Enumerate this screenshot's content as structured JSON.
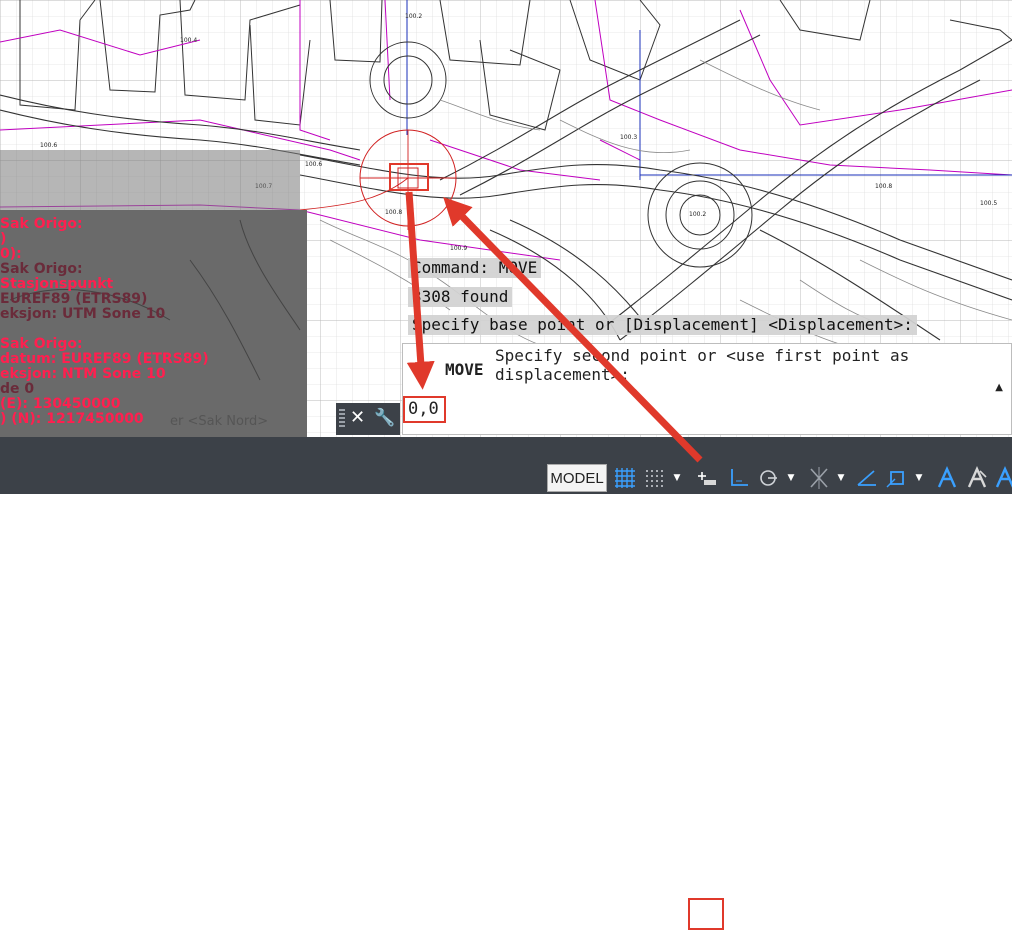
{
  "drawing": {
    "sidebar_lines": [
      {
        "text": "Sak Origo:",
        "tone": "red"
      },
      {
        "text": ")",
        "tone": "red"
      },
      {
        "text": "0):",
        "tone": "red"
      },
      {
        "text": "Sak Origo:",
        "tone": "dim"
      },
      {
        "text": "Stasjonspunkt",
        "tone": "red"
      },
      {
        "text": "EUREF89 (ETRS89)",
        "tone": "dim"
      },
      {
        "text": "eksjon: UTM Sone 10",
        "tone": "dim"
      },
      {
        "text": "",
        "tone": "dim"
      },
      {
        "text": "Sak Origo:",
        "tone": "red"
      },
      {
        "text": "datum: EUREF89 (ETRS89)",
        "tone": "red"
      },
      {
        "text": "eksjon: NTM Sone 10",
        "tone": "red"
      },
      {
        "text": "de 0",
        "tone": "dim"
      },
      {
        "text": "(E): 130450000",
        "tone": "red"
      },
      {
        "text": ") (N): 1217450000",
        "tone": "red"
      }
    ],
    "sidebar_note": "er <Sak Nord>"
  },
  "command_history": [
    "Command: MOVE",
    "3308 found",
    "Specify base point or [Displacement] <Displacement>:"
  ],
  "command_line": {
    "command_name": "MOVE",
    "prompt": "Specify second point or <use first point as displacement>:",
    "input_value": "0,0",
    "close_icon": "close-icon",
    "customize_icon": "wrench-icon"
  },
  "statusbar": {
    "model_label": "MODEL",
    "icons": [
      "grid-icon",
      "snap-mode-icon",
      "dynamic-input-icon",
      "ortho-icon",
      "polar-tracking-icon",
      "isodraft-icon",
      "object-snap-tracking-icon",
      "object-snap-icon",
      "annotation-visibility-icon",
      "auto-scale-icon"
    ]
  },
  "colors": {
    "statusbar_bg": "#3c4148",
    "highlight_red": "#e0392b",
    "drawing_magenta": "#c000c0",
    "drawing_blue": "#1a2fb8",
    "sidebar_text_red": "#ff1f4f"
  }
}
